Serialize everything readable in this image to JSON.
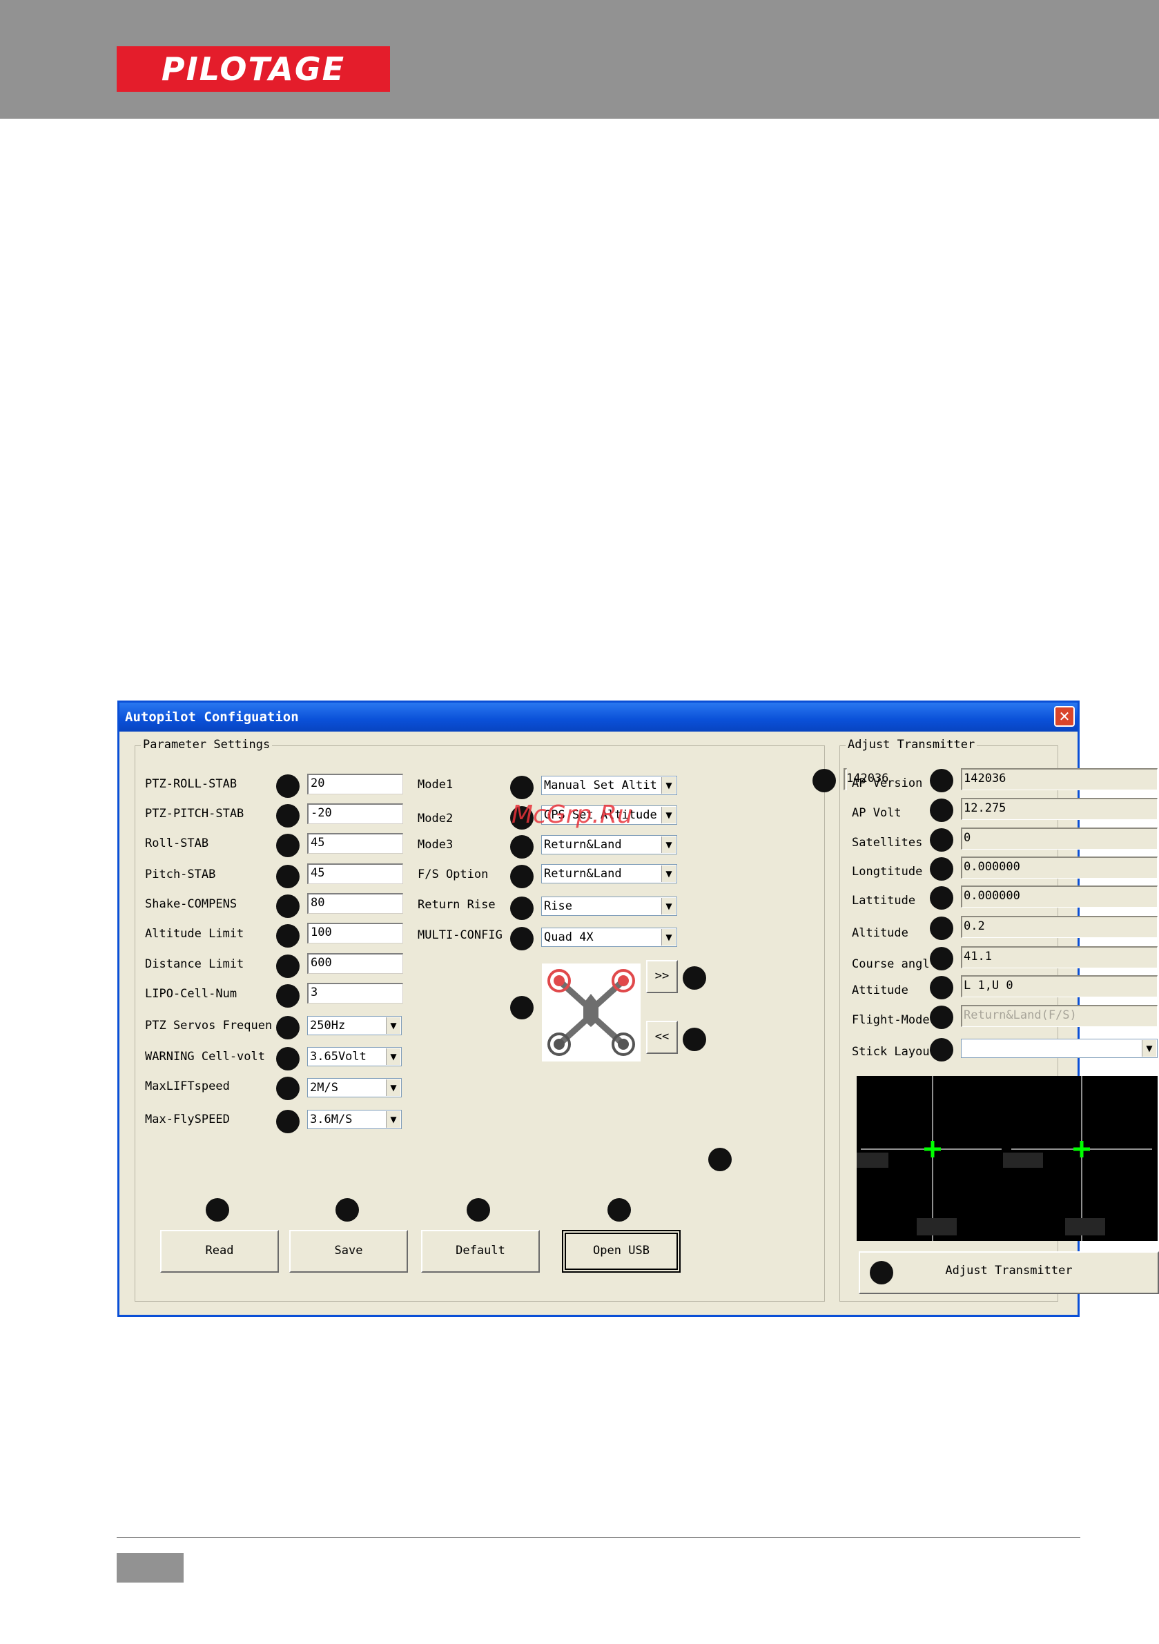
{
  "brand": {
    "logo_text": "PILOTAGE",
    "accent": "#e41d2b"
  },
  "window": {
    "title": "Autopilot Configuation",
    "close_icon": "close-icon"
  },
  "watermark": "McGrp.Ru",
  "parameter_settings": {
    "title": "Parameter Settings",
    "text_fields": [
      {
        "label": "PTZ-ROLL-STAB",
        "value": "20"
      },
      {
        "label": "PTZ-PITCH-STAB",
        "value": "-20"
      },
      {
        "label": "Roll-STAB",
        "value": "45"
      },
      {
        "label": "Pitch-STAB",
        "value": "45"
      },
      {
        "label": "Shake-COMPENS",
        "value": "80"
      },
      {
        "label": "Altitude Limit",
        "value": "100"
      },
      {
        "label": "Distance Limit",
        "value": "600"
      },
      {
        "label": "LIPO-Cell-Num",
        "value": "3"
      }
    ],
    "select_fields": [
      {
        "label": "PTZ Servos  Frequen",
        "value": "250Hz"
      },
      {
        "label": "WARNING Cell-volt",
        "value": "3.65Volt"
      },
      {
        "label": "MaxLIFTspeed",
        "value": "2M/S"
      },
      {
        "label": "Max-FlySPEED",
        "value": "3.6M/S"
      }
    ],
    "mode_fields": [
      {
        "label": "Mode1",
        "value": "Manual Set Altit"
      },
      {
        "label": "Mode2",
        "value": "GPS Set Altitude"
      },
      {
        "label": "Mode3",
        "value": "Return&Land"
      },
      {
        "label": "F/S Option",
        "value": "Return&Land"
      },
      {
        "label": "Return Rise",
        "value": "Rise"
      },
      {
        "label": "MULTI-CONFIG",
        "value": "Quad 4X"
      }
    ],
    "next_button": ">>",
    "prev_button": "<<",
    "buttons": {
      "read": "Read",
      "save": "Save",
      "default": "Default",
      "open_usb": "Open USB"
    }
  },
  "adjust_transmitter": {
    "title": "Adjust Transmitter",
    "fields": [
      {
        "label": "AP Version",
        "value": "142036"
      },
      {
        "label": "AP Volt",
        "value": "12.275"
      },
      {
        "label": "Satellites",
        "value": "0"
      },
      {
        "label": "Longtitude",
        "value": "0.000000"
      },
      {
        "label": "Lattitude",
        "value": "0.000000"
      },
      {
        "label": "Altitude",
        "value": "0.2"
      },
      {
        "label": "Course angl",
        "value": "41.1"
      },
      {
        "label": "Attitude",
        "value": "L 1,U 0"
      },
      {
        "label": "Flight-Mode",
        "value": "Return&Land(F/S)"
      }
    ],
    "stick_layout": {
      "label": "Stick Layou",
      "value": ""
    },
    "stick_cursor_color": "#00ff00",
    "button": "Adjust Transmitter"
  }
}
